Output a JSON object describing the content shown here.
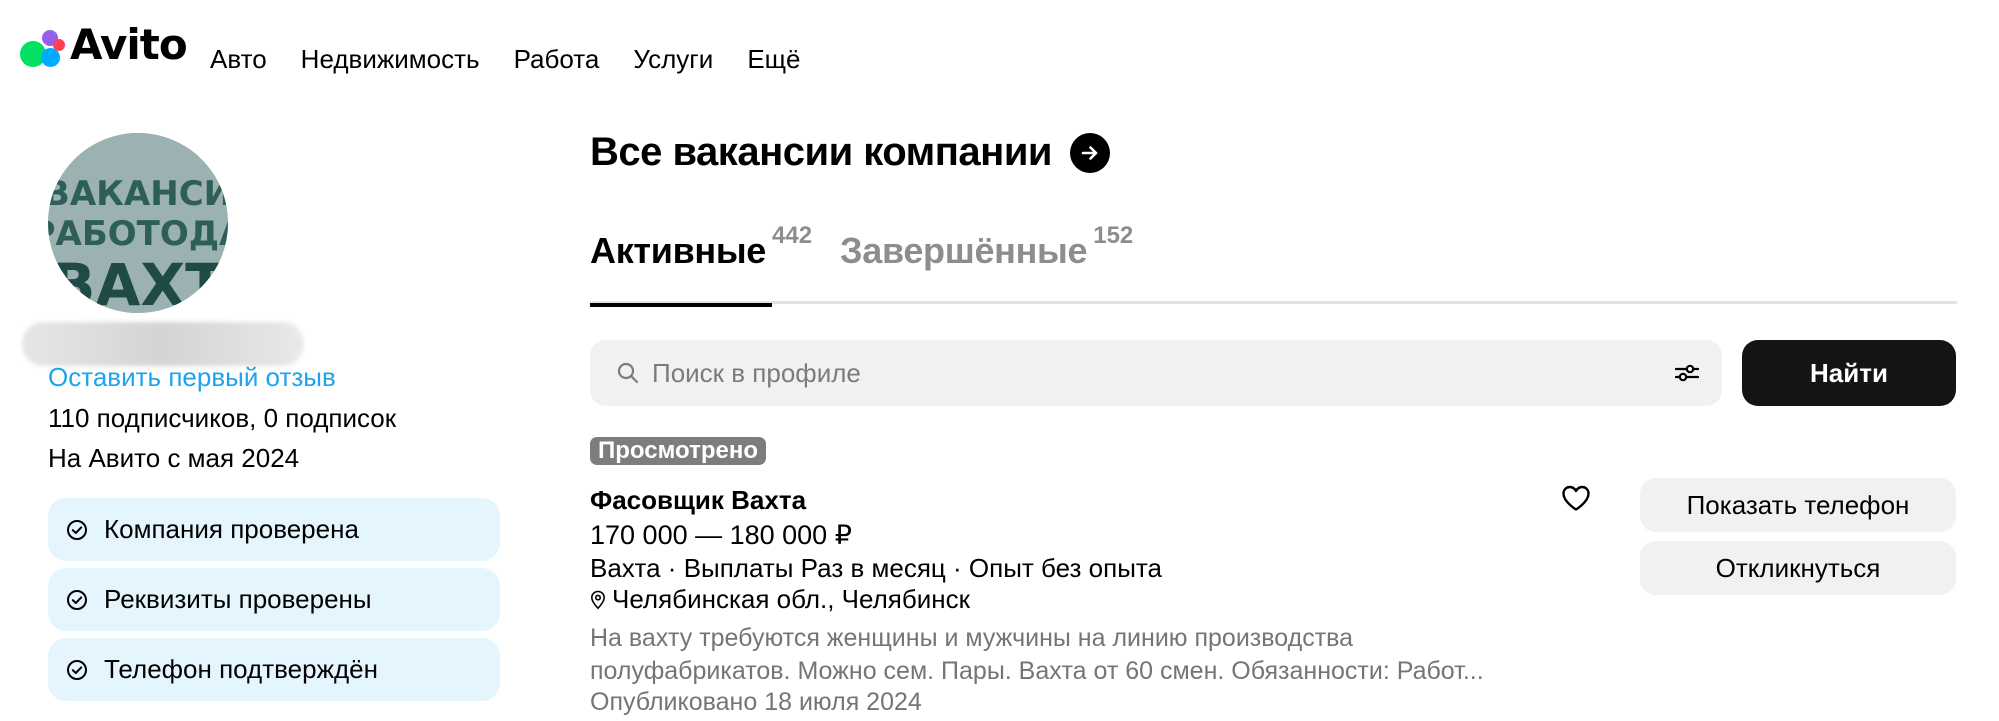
{
  "header": {
    "logo_text": "Avito",
    "nav": [
      "Авто",
      "Недвижимость",
      "Работа",
      "Услуги",
      "Ещё"
    ]
  },
  "sidebar": {
    "avatar_text": [
      "ВАКАНСИ",
      "РАБОТОДА",
      "ВАХТ"
    ],
    "review_link": "Оставить первый отзыв",
    "subscribers": "110 подписчиков, 0 подписок",
    "since": "На Авито с мая 2024",
    "badges": [
      {
        "label": "Компания проверена",
        "icon": "check-circle-icon"
      },
      {
        "label": "Реквизиты проверены",
        "icon": "check-circle-icon"
      },
      {
        "label": "Телефон подтверждён",
        "icon": "check-circle-icon"
      }
    ]
  },
  "main": {
    "section_title": "Все вакансии компании",
    "tabs": [
      {
        "label": "Активные",
        "count": "442",
        "active": true
      },
      {
        "label": "Завершённые",
        "count": "152",
        "active": false
      }
    ],
    "search": {
      "placeholder": "Поиск в профиле",
      "button": "Найти"
    },
    "vacancy": {
      "viewed_badge": "Просмотрено",
      "title": "Фасовщик Вахта",
      "salary": "170 000 — 180 000 ₽",
      "tags": "Вахта · Выплаты Раз в месяц · Опыт без опыта",
      "location": "Челябинская обл., Челябинск",
      "description_line1": "На вахту требуются женщины и мужчины на линию производства",
      "description_line2": "полуфабрикатов. Можно сем. Пары. Вахта от 60 смен. Обязанности: Работ...",
      "published": "Опубликовано 18 июля 2024",
      "show_phone": "Показать телефон",
      "respond": "Откликнуться"
    }
  },
  "colors": {
    "link": "#1ea3ec",
    "badge_bg": "#e5f5fe",
    "button_dark": "#141414",
    "muted_text": "#757575"
  }
}
